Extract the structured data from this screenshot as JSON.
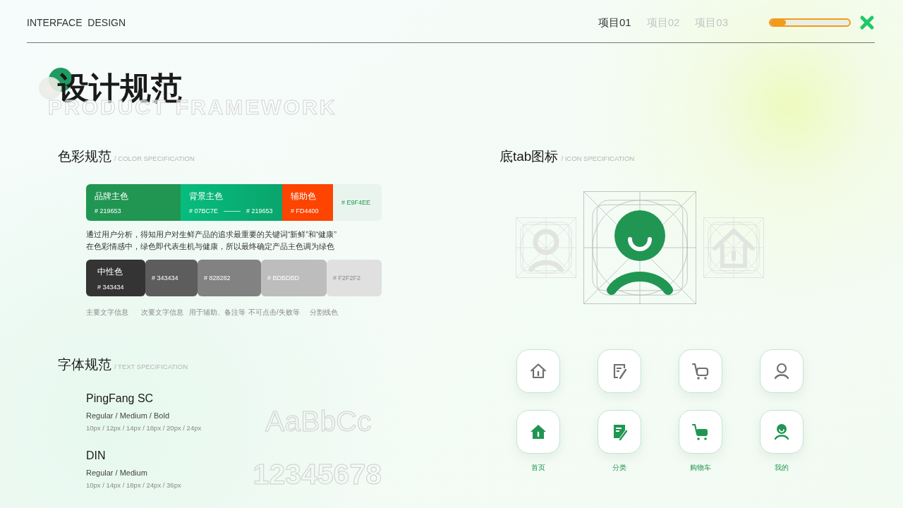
{
  "header": {
    "brand": "INTERFACE  DESIGN",
    "tabs": [
      {
        "label": "项目01",
        "selected": true
      },
      {
        "label": "项目02",
        "selected": false
      },
      {
        "label": "项目03",
        "selected": false
      }
    ],
    "progress": {
      "level": 0.2
    }
  },
  "title": {
    "heading": "设计规范",
    "subtitle": "PRODUCT FRAMEWORK"
  },
  "color_spec": {
    "title": "色彩规范",
    "subtitle": "/ COLOR SPECIFICATION",
    "brand_swatches": [
      {
        "kind": "solid",
        "label": "品牌主色",
        "codes": [
          "# 219653"
        ],
        "color": "#219653"
      },
      {
        "kind": "gradient",
        "label": "背景主色",
        "codes": [
          "# 07BC7E",
          "# 219653"
        ],
        "color": "#07bc7e"
      },
      {
        "kind": "solid",
        "label": "辅助色",
        "codes": [
          "# FD4400"
        ],
        "color": "#fd4400"
      },
      {
        "kind": "light",
        "codes": [
          "# E9F4EE"
        ],
        "color": "#e9f4ee"
      }
    ],
    "note": [
      "通过用户分析，得知用户对生鲜产品的追求最重要的关键词“新鲜”和“健康”",
      "在色彩情感中，绿色即代表生机与健康，所以最终确定产品主色调为绿色"
    ],
    "neutral_swatches": [
      {
        "label": "中性色",
        "code": "# 343434",
        "color": "#343434",
        "usage": "主要文字信息"
      },
      {
        "code": "# 343434",
        "color": "#5e5d5d",
        "usage": "次要文字信息"
      },
      {
        "code": "# 828282",
        "color": "#828282",
        "usage": "用于辅助、备注等"
      },
      {
        "code": "# BDBDBD",
        "color": "#bdbdbd",
        "usage": "不可点击/失败等"
      },
      {
        "code": "# F2F2F2",
        "color": "#e0e0e0",
        "usage": "分割线色"
      }
    ]
  },
  "text_spec": {
    "title": "字体规范",
    "subtitle": "/ TEXT SPECIFICATION",
    "fonts": [
      {
        "name": "PingFang SC",
        "weights": "Regular / Medium / Bold",
        "sizes": "10px / 12px / 14px / 18px / 20px  / 24px",
        "sample": "AaBbCc"
      },
      {
        "name": "DIN",
        "weights": "Regular / Medium",
        "sizes": "10px / 14px / 18px / 24px  / 36px",
        "sample": "12345678"
      }
    ]
  },
  "icon_spec": {
    "title": "底tab图标",
    "subtitle": "/ ICON SPECIFICATION",
    "grid_drawings": [
      {
        "kind": "user",
        "selected": false
      },
      {
        "kind": "user",
        "selected": true
      },
      {
        "kind": "home",
        "selected": false
      }
    ],
    "rows": [
      {
        "selected": false,
        "items": [
          {
            "kind": "home"
          },
          {
            "kind": "note"
          },
          {
            "kind": "cart"
          },
          {
            "kind": "user"
          }
        ]
      },
      {
        "selected": true,
        "items": [
          {
            "kind": "home",
            "label": "首页"
          },
          {
            "kind": "note",
            "label": "分类"
          },
          {
            "kind": "cart",
            "label": "购物车"
          },
          {
            "kind": "user",
            "label": "我的"
          }
        ]
      }
    ]
  }
}
